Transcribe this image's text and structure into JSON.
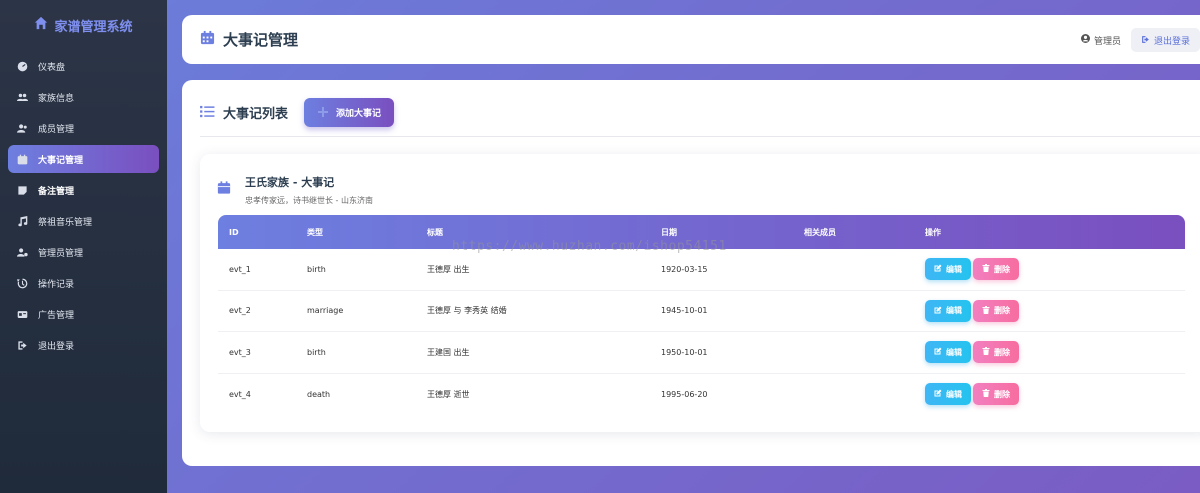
{
  "brand": {
    "title": "家谱管理系统",
    "icon": "home-icon"
  },
  "sidebar": {
    "items": [
      {
        "label": "仪表盘",
        "icon": "dashboard-icon"
      },
      {
        "label": "家族信息",
        "icon": "users-icon"
      },
      {
        "label": "成员管理",
        "icon": "user-group-icon"
      },
      {
        "label": "大事记管理",
        "icon": "calendar-icon",
        "active": true
      },
      {
        "label": "备注管理",
        "icon": "note-icon"
      },
      {
        "label": "祭祖音乐管理",
        "icon": "music-icon"
      },
      {
        "label": "管理员管理",
        "icon": "user-cog-icon"
      },
      {
        "label": "操作记录",
        "icon": "history-icon"
      },
      {
        "label": "广告管理",
        "icon": "ad-icon"
      },
      {
        "label": "退出登录",
        "icon": "sign-out-icon"
      }
    ]
  },
  "header": {
    "title": "大事记管理",
    "admin_label": "管理员",
    "logout_label": "退出登录"
  },
  "main": {
    "list_title": "大事记列表",
    "add_button": "添加大事记",
    "family": {
      "name": "王氏家族 - 大事记",
      "subtitle": "忠孝传家远，诗书继世长 - 山东济南"
    },
    "table": {
      "columns": [
        "ID",
        "类型",
        "标题",
        "日期",
        "相关成员",
        "操作"
      ],
      "rows": [
        {
          "id": "evt_1",
          "type": "birth",
          "title": "王德厚 出生",
          "date": "1920-03-15",
          "members": ""
        },
        {
          "id": "evt_2",
          "type": "marriage",
          "title": "王德厚 与 李秀英 结婚",
          "date": "1945-10-01",
          "members": ""
        },
        {
          "id": "evt_3",
          "type": "birth",
          "title": "王建国 出生",
          "date": "1950-10-01",
          "members": ""
        },
        {
          "id": "evt_4",
          "type": "death",
          "title": "王德厚 逝世",
          "date": "1995-06-20",
          "members": ""
        }
      ],
      "edit_label": "编辑",
      "delete_label": "删除"
    }
  },
  "watermark": "https://www.huzhan.com/ishop54151",
  "colors": {
    "accent": "#6d7fe0",
    "accent2": "#7a4fbf",
    "edit": "#24c3ef",
    "delete": "#f76da0"
  }
}
